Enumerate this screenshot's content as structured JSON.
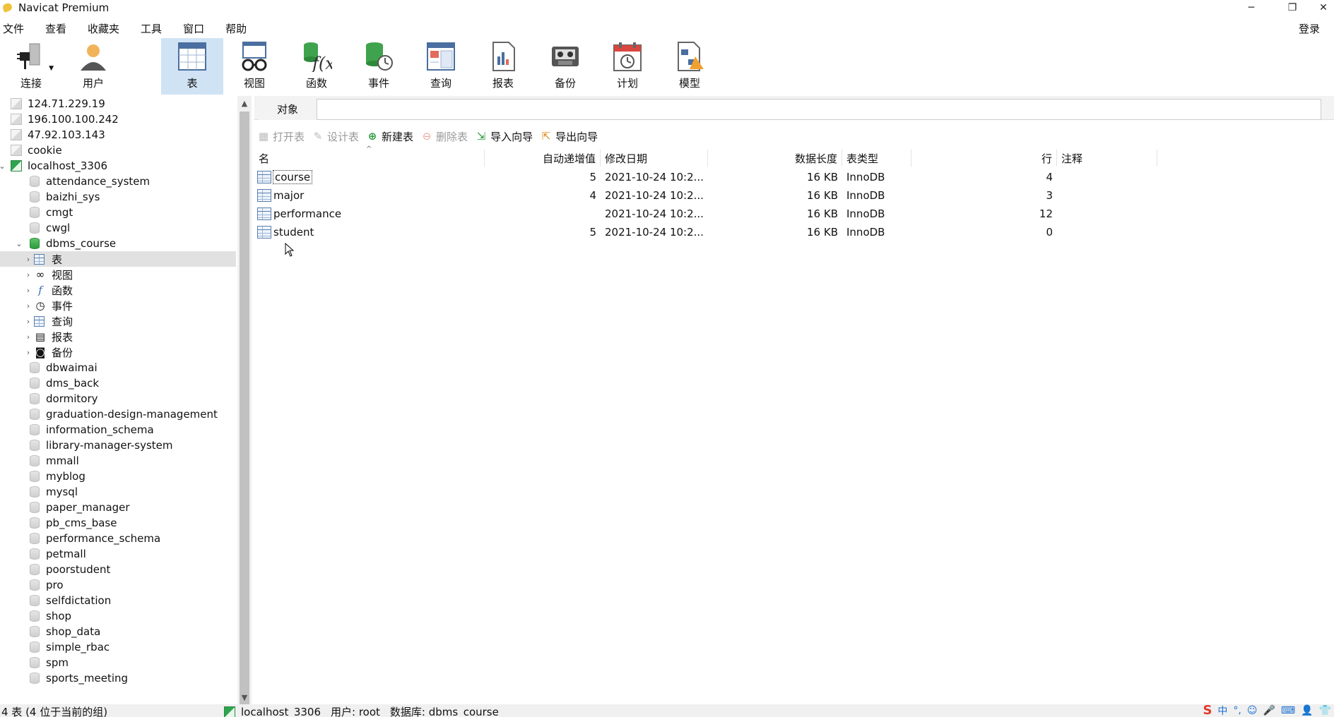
{
  "window": {
    "title": "Navicat Premium",
    "minimize": "─",
    "restore": "❐",
    "close": "✕"
  },
  "menu": [
    "文件",
    "查看",
    "收藏夹",
    "工具",
    "窗口",
    "帮助"
  ],
  "login_label": "登录",
  "toolbar": {
    "connect": "连接",
    "user": "用户",
    "table": "表",
    "view": "视图",
    "function": "函数",
    "event": "事件",
    "query": "查询",
    "report": "报表",
    "backup": "备份",
    "schedule": "计划",
    "model": "模型"
  },
  "tree": {
    "connections_top": [
      "124.71.229.19",
      "196.100.100.242",
      "47.92.103.143",
      "cookie"
    ],
    "localhost": "localhost_3306",
    "dbs_before": [
      "attendance_system",
      "baizhi_sys",
      "cmgt",
      "cwgl"
    ],
    "open_db": "dbms_course",
    "open_db_children": [
      "表",
      "视图",
      "函数",
      "事件",
      "查询",
      "报表",
      "备份"
    ],
    "dbs_after": [
      "dbwaimai",
      "dms_back",
      "dormitory",
      "graduation-design-management",
      "information_schema",
      "library-manager-system",
      "mmall",
      "myblog",
      "mysql",
      "paper_manager",
      "pb_cms_base",
      "performance_schema",
      "petmall",
      "poorstudent",
      "pro",
      "selfdictation",
      "shop",
      "shop_data",
      "simple_rbac",
      "spm",
      "sports_meeting"
    ]
  },
  "tab": {
    "objects": "对象"
  },
  "objbar": {
    "open_table": "打开表",
    "design_table": "设计表",
    "new_table": "新建表",
    "delete_table": "删除表",
    "import_wizard": "导入向导",
    "export_wizard": "导出向导"
  },
  "grid": {
    "headers": {
      "name": "名",
      "auto_inc": "自动递增值",
      "modified": "修改日期",
      "data_length": "数据长度",
      "engine": "表类型",
      "rows": "行",
      "comment": "注释"
    },
    "rows": [
      {
        "name": "course",
        "auto_inc": "5",
        "modified": "2021-10-24 10:2...",
        "data_length": "16 KB",
        "engine": "InnoDB",
        "rows": "4",
        "comment": ""
      },
      {
        "name": "major",
        "auto_inc": "4",
        "modified": "2021-10-24 10:2...",
        "data_length": "16 KB",
        "engine": "InnoDB",
        "rows": "3",
        "comment": ""
      },
      {
        "name": "performance",
        "auto_inc": "",
        "modified": "2021-10-24 10:2...",
        "data_length": "16 KB",
        "engine": "InnoDB",
        "rows": "12",
        "comment": ""
      },
      {
        "name": "student",
        "auto_inc": "5",
        "modified": "2021-10-24 10:2...",
        "data_length": "16 KB",
        "engine": "InnoDB",
        "rows": "0",
        "comment": ""
      }
    ]
  },
  "status": {
    "left": "4 表 (4 位于当前的组)",
    "connection": "localhost_3306",
    "user": "用户: root",
    "database": "数据库: dbms_course"
  },
  "tray": [
    "中",
    "°,",
    "☺",
    "🎤",
    "⌨",
    "👤",
    "👕"
  ]
}
